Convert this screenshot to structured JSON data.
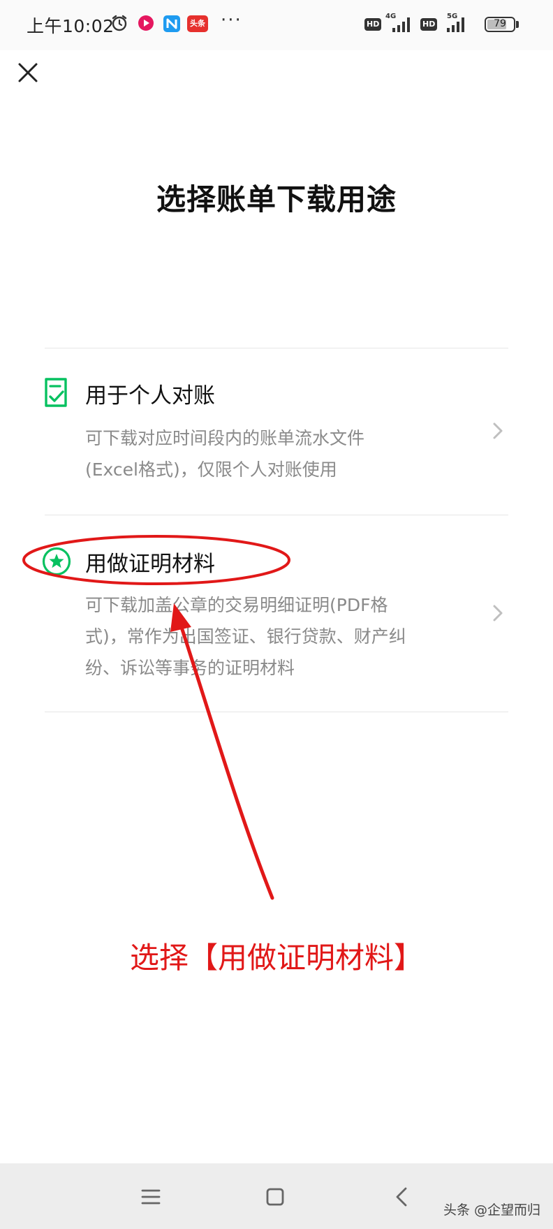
{
  "status_bar": {
    "time": "上午10:02",
    "app_badge_label": "头条",
    "network_1": "4G",
    "network_2": "5G",
    "hd_label": "HD",
    "battery_level": "79",
    "more_label": "···"
  },
  "page": {
    "title": "选择账单下载用途"
  },
  "options": [
    {
      "title": "用于个人对账",
      "desc_lines": [
        "可下载对应时间段内的账单流水文件",
        "(Excel格式)，仅限个人对账使用"
      ],
      "icon": "document-check-icon"
    },
    {
      "title": "用做证明材料",
      "desc_lines": [
        "可下载加盖公章的交易明细证明(PDF格",
        "式)，常作为出国签证、银行贷款、财产纠",
        "纷、诉讼等事务的证明材料"
      ],
      "icon": "star-badge-icon"
    }
  ],
  "annotation": {
    "caption": "选择【用做证明材料】",
    "color": "#e11818"
  },
  "nav_bar": {
    "watermark": "头条 @企望而归"
  },
  "colors": {
    "accent_green": "#07c160",
    "text_primary": "#111111",
    "text_secondary": "#8a8a8a",
    "divider": "#e6e6e6"
  }
}
